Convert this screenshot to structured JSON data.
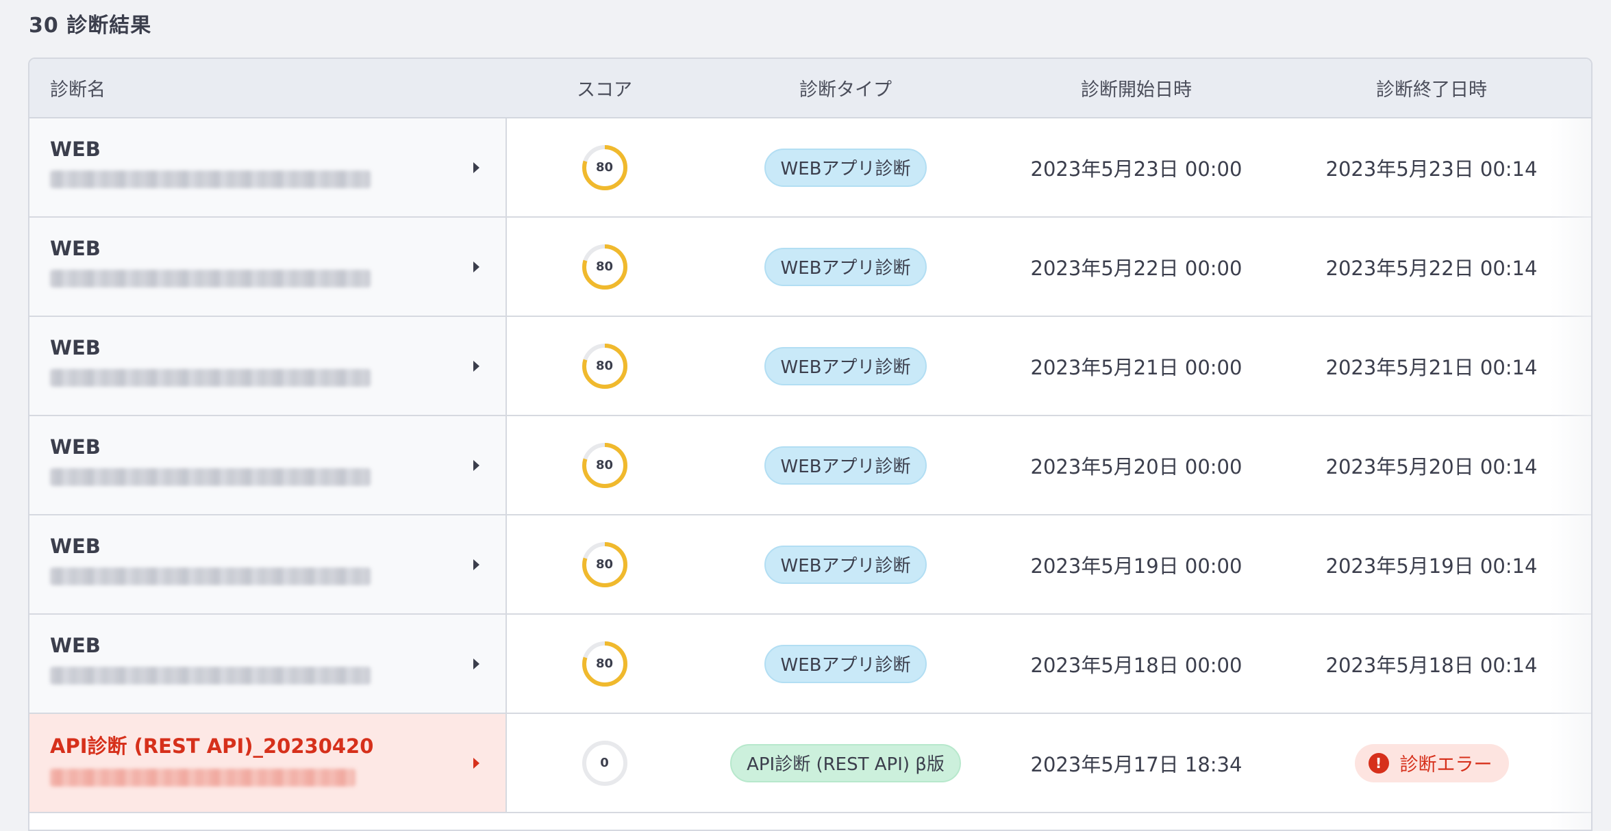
{
  "header": {
    "title": "30 診断結果"
  },
  "table": {
    "columns": {
      "name": "診断名",
      "score": "スコア",
      "type": "診断タイプ",
      "start": "診断開始日時",
      "end": "診断終了日時"
    },
    "rows": [
      {
        "name": "WEB",
        "score": 80,
        "type": "WEBアプリ診断",
        "type_kind": "web",
        "start": "2023年5月23日 00:00",
        "end": "2023年5月23日 00:14",
        "error": false
      },
      {
        "name": "WEB",
        "score": 80,
        "type": "WEBアプリ診断",
        "type_kind": "web",
        "start": "2023年5月22日 00:00",
        "end": "2023年5月22日 00:14",
        "error": false
      },
      {
        "name": "WEB",
        "score": 80,
        "type": "WEBアプリ診断",
        "type_kind": "web",
        "start": "2023年5月21日 00:00",
        "end": "2023年5月21日 00:14",
        "error": false
      },
      {
        "name": "WEB",
        "score": 80,
        "type": "WEBアプリ診断",
        "type_kind": "web",
        "start": "2023年5月20日 00:00",
        "end": "2023年5月20日 00:14",
        "error": false
      },
      {
        "name": "WEB",
        "score": 80,
        "type": "WEBアプリ診断",
        "type_kind": "web",
        "start": "2023年5月19日 00:00",
        "end": "2023年5月19日 00:14",
        "error": false
      },
      {
        "name": "WEB",
        "score": 80,
        "type": "WEBアプリ診断",
        "type_kind": "web",
        "start": "2023年5月18日 00:00",
        "end": "2023年5月18日 00:14",
        "error": false
      },
      {
        "name": "API診断 (REST API)_20230420",
        "score": 0,
        "type": "API診断 (REST API) β版",
        "type_kind": "api",
        "start": "2023年5月17日 18:34",
        "end": "診断エラー",
        "error": true
      }
    ]
  },
  "colors": {
    "gauge_fill": "#f0b92d",
    "gauge_track": "#e8e9ec",
    "error_red": "#d6301b",
    "web_badge": "#c9e9f8",
    "api_badge": "#ccf0dc"
  },
  "icons": {
    "row_chevron": "chevron-right-icon",
    "error": "exclamation-circle-icon"
  }
}
